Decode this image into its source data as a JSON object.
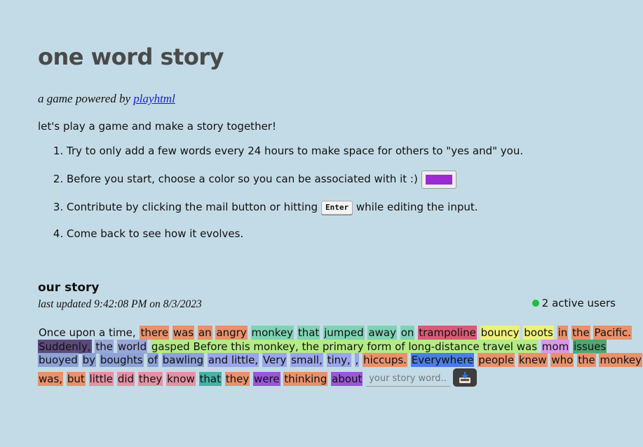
{
  "title": "one word story",
  "subtitle_prefix": "a game powered by ",
  "subtitle_link": "playhtml",
  "intro": "let's play a game and make a story together!",
  "rules": {
    "r1": "Try to only add a few words every 24 hours to make space for others to \"yes and\" you.",
    "r2": "Before you start, choose a color so you can be associated with it :)",
    "r3_before": "Contribute by clicking the mail button or hitting",
    "r3_key": "Enter",
    "r3_after": "while editing the input.",
    "r4": "Come back to see how it evolves."
  },
  "color_swatch": "#9b2bd0",
  "story_heading": "our story",
  "last_updated": "last updated 9:42:08 PM on 8/3/2023",
  "active_users": "2 active users",
  "story_input_placeholder": "your story word...",
  "icons": {
    "send": "mail-send-icon",
    "active": "green-dot-icon"
  },
  "story_lines": [
    [
      {
        "t": "Once upon a time,",
        "c": ""
      },
      {
        "t": "there",
        "c": "#e8916b"
      },
      {
        "t": "was",
        "c": "#e8916b"
      },
      {
        "t": "an",
        "c": "#e8916b"
      },
      {
        "t": "angry",
        "c": "#e8916b"
      },
      {
        "t": "monkey",
        "c": "#7fd3b4"
      },
      {
        "t": "that",
        "c": "#7fd3b4"
      },
      {
        "t": "jumped",
        "c": "#7fd3b4"
      },
      {
        "t": "away",
        "c": "#7fd3b4"
      },
      {
        "t": "on",
        "c": "#7fd3b4"
      },
      {
        "t": "trampoline",
        "c": "#d95a76"
      },
      {
        "t": "bouncy",
        "c": "#eef07c"
      },
      {
        "t": "boots",
        "c": "#eef07c"
      },
      {
        "t": "in",
        "c": "#e8916b"
      },
      {
        "t": "the",
        "c": "#e8916b"
      },
      {
        "t": "Pacific.",
        "c": "#e8916b"
      }
    ],
    [
      {
        "t": "Suddenly,",
        "c": "#5a4a7a"
      },
      {
        "t": "the",
        "c": "#9aa6d6"
      },
      {
        "t": "world",
        "c": "#9aa6d6"
      },
      {
        "t": "gasped Before this monkey, the primary form of long-distance travel was",
        "c": "#b3ec84"
      },
      {
        "t": "mom",
        "c": "#d898e8"
      },
      {
        "t": "issues",
        "c": "#4fa672"
      }
    ],
    [
      {
        "t": "buoyed",
        "c": "#8da2d6"
      },
      {
        "t": "by",
        "c": "#8da2d6"
      },
      {
        "t": "boughts",
        "c": "#8da2d6"
      },
      {
        "t": "of",
        "c": "#8da2d6"
      },
      {
        "t": "bawling",
        "c": "#8da2d6"
      },
      {
        "t": "and little,",
        "c": "#9aa6e6"
      },
      {
        "t": "Very",
        "c": "#9aa6e6"
      },
      {
        "t": "small,",
        "c": "#9aa6e6"
      },
      {
        "t": "tiny,",
        "c": "#9aa6e6"
      },
      {
        "t": ",",
        "c": "#9aa6e6"
      },
      {
        "t": "hiccups.",
        "c": "#e8916b"
      },
      {
        "t": "Everywhere",
        "c": "#4b7ce8"
      },
      {
        "t": "people",
        "c": "#e8916b"
      },
      {
        "t": "knew",
        "c": "#e8916b"
      },
      {
        "t": "who",
        "c": "#e8916b"
      },
      {
        "t": "the",
        "c": "#e8916b"
      },
      {
        "t": "monkey",
        "c": "#e8916b"
      }
    ],
    [
      {
        "t": "was,",
        "c": "#e8916b"
      },
      {
        "t": "but",
        "c": "#e8916b"
      },
      {
        "t": "little",
        "c": "#e590a4"
      },
      {
        "t": "did",
        "c": "#e590a4"
      },
      {
        "t": "they",
        "c": "#e590a4"
      },
      {
        "t": "know",
        "c": "#e590a4"
      },
      {
        "t": "that",
        "c": "#43b3a4"
      },
      {
        "t": "they",
        "c": "#e8916b"
      },
      {
        "t": "were",
        "c": "#9b55d6"
      },
      {
        "t": "thinking",
        "c": "#e8916b"
      },
      {
        "t": "about",
        "c": "#9b55d6"
      }
    ]
  ]
}
